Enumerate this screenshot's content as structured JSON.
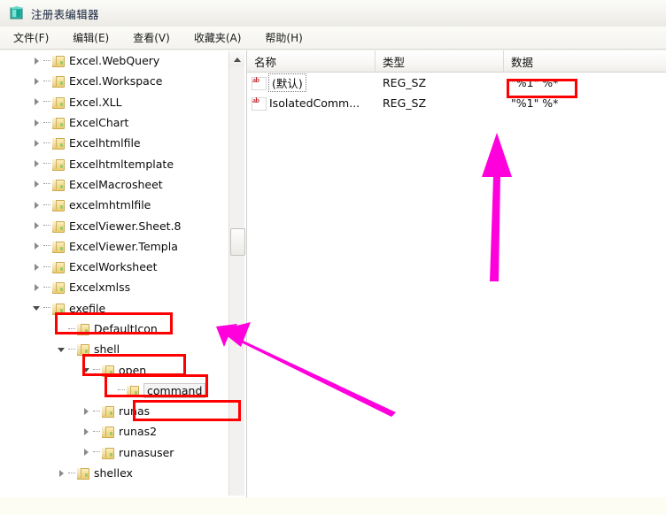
{
  "window": {
    "title": "注册表编辑器",
    "icon": "registry-editor-icon"
  },
  "menubar": {
    "items": [
      {
        "label": "文件(F)",
        "name": "menu-file"
      },
      {
        "label": "编辑(E)",
        "name": "menu-edit"
      },
      {
        "label": "查看(V)",
        "name": "menu-view"
      },
      {
        "label": "收藏夹(A)",
        "name": "menu-favorites"
      },
      {
        "label": "帮助(H)",
        "name": "menu-help"
      }
    ]
  },
  "tree": {
    "items": [
      {
        "label": "Excel.WebQuery",
        "indent": 1,
        "state": "collapsed",
        "highlight": false
      },
      {
        "label": "Excel.Workspace",
        "indent": 1,
        "state": "collapsed",
        "highlight": false
      },
      {
        "label": "Excel.XLL",
        "indent": 1,
        "state": "collapsed",
        "highlight": false
      },
      {
        "label": "ExcelChart",
        "indent": 1,
        "state": "collapsed",
        "highlight": false
      },
      {
        "label": "Excelhtmlfile",
        "indent": 1,
        "state": "collapsed",
        "highlight": false
      },
      {
        "label": "Excelhtmltemplate",
        "indent": 1,
        "state": "collapsed",
        "highlight": false
      },
      {
        "label": "ExcelMacrosheet",
        "indent": 1,
        "state": "collapsed",
        "highlight": false
      },
      {
        "label": "excelmhtmlfile",
        "indent": 1,
        "state": "collapsed",
        "highlight": false
      },
      {
        "label": "ExcelViewer.Sheet.8",
        "indent": 1,
        "state": "collapsed",
        "highlight": false
      },
      {
        "label": "ExcelViewer.Templa",
        "indent": 1,
        "state": "collapsed",
        "highlight": false
      },
      {
        "label": "ExcelWorksheet",
        "indent": 1,
        "state": "collapsed",
        "highlight": false
      },
      {
        "label": "Excelxmlss",
        "indent": 1,
        "state": "collapsed",
        "highlight": false
      },
      {
        "label": "exefile",
        "indent": 1,
        "state": "expanded",
        "highlight": true
      },
      {
        "label": "DefaultIcon",
        "indent": 2,
        "state": "leaf",
        "highlight": false
      },
      {
        "label": "shell",
        "indent": 2,
        "state": "expanded",
        "highlight": true
      },
      {
        "label": "open",
        "indent": 3,
        "state": "expanded",
        "highlight": true
      },
      {
        "label": "command",
        "indent": 4,
        "state": "leaf",
        "highlight": true,
        "selected": true
      },
      {
        "label": "runas",
        "indent": 3,
        "state": "collapsed",
        "highlight": false
      },
      {
        "label": "runas2",
        "indent": 3,
        "state": "collapsed",
        "highlight": false
      },
      {
        "label": "runasuser",
        "indent": 3,
        "state": "collapsed",
        "highlight": false
      },
      {
        "label": "shellex",
        "indent": 2,
        "state": "collapsed",
        "highlight": false
      }
    ]
  },
  "list": {
    "columns": [
      {
        "label": "名称",
        "name": "column-name"
      },
      {
        "label": "类型",
        "name": "column-type"
      },
      {
        "label": "数据",
        "name": "column-data"
      }
    ],
    "rows": [
      {
        "name": "(默认)",
        "type": "REG_SZ",
        "data": "\"%1\" %*",
        "icon": "string-value-icon",
        "focused": true,
        "data_highlight": true
      },
      {
        "name": "IsolatedComm...",
        "type": "REG_SZ",
        "data": "\"%1\" %*",
        "icon": "string-value-icon",
        "focused": false,
        "data_highlight": false
      }
    ]
  },
  "annotations": {
    "highlight_color": "#ff0000",
    "arrow_color": "#ff00dd",
    "arrows": [
      {
        "name": "arrow-up-to-data-value",
        "direction": "up"
      },
      {
        "name": "arrow-diagonal-to-exefile",
        "direction": "up-left"
      },
      {
        "name": "arrow-line-lower-right",
        "direction": "up-left"
      }
    ]
  }
}
